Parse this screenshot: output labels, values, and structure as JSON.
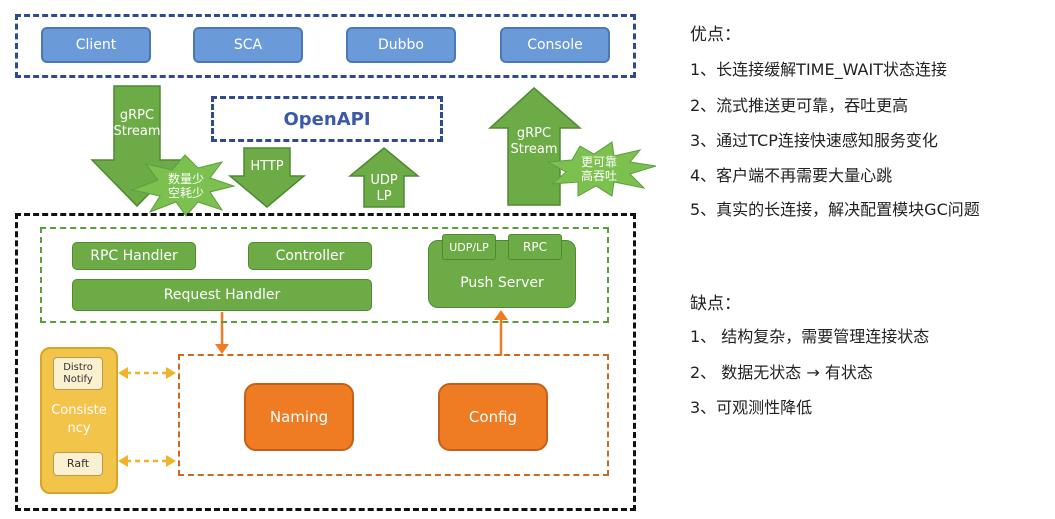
{
  "clients": {
    "client": "Client",
    "sca": "SCA",
    "dubbo": "Dubbo",
    "console": "Console"
  },
  "openapi": "OpenAPI",
  "arrows": {
    "grpc_stream_left_line1": "gRPC",
    "grpc_stream_left_line2": "Stream",
    "http": "HTTP",
    "udp_line1": "UDP",
    "udp_line2": "LP",
    "grpc_stream_right_line1": "gRPC",
    "grpc_stream_right_line2": "Stream"
  },
  "bursts": {
    "left_line1": "数量少",
    "left_line2": "空耗少",
    "right_line1": "更可靠",
    "right_line2": "高吞吐"
  },
  "server": {
    "rpc_handler": "RPC Handler",
    "controller": "Controller",
    "request_handler": "Request Handler",
    "push_server": "Push Server",
    "udp_lp_tab": "UDP/LP",
    "rpc_tab": "RPC"
  },
  "consistency": {
    "label_line1": "Consiste",
    "label_line2": "ncy",
    "distro_line1": "Distro",
    "distro_line2": "Notify",
    "raft": "Raft"
  },
  "modules": {
    "naming": "Naming",
    "config": "Config"
  },
  "notes": {
    "pros_title": "优点：",
    "pros": [
      "1、长连接缓解TIME_WAIT状态连接",
      "2、流式推送更可靠，吞吐更高",
      "3、通过TCP连接快速感知服务变化",
      "4、客户端不再需要大量心跳",
      "5、真实的长连接，解决配置模块GC问题"
    ],
    "cons_title": "缺点：",
    "cons": [
      "1、 结构复杂，需要管理连接状态",
      "2、 数据无状态 → 有状态",
      "3、可观测性降低"
    ]
  },
  "colors": {
    "blue_box": "#6b9ad8",
    "green": "#6dab47",
    "orange": "#ef7b22",
    "yellow": "#f3c44a",
    "dash_blue": "#2e4a93"
  }
}
